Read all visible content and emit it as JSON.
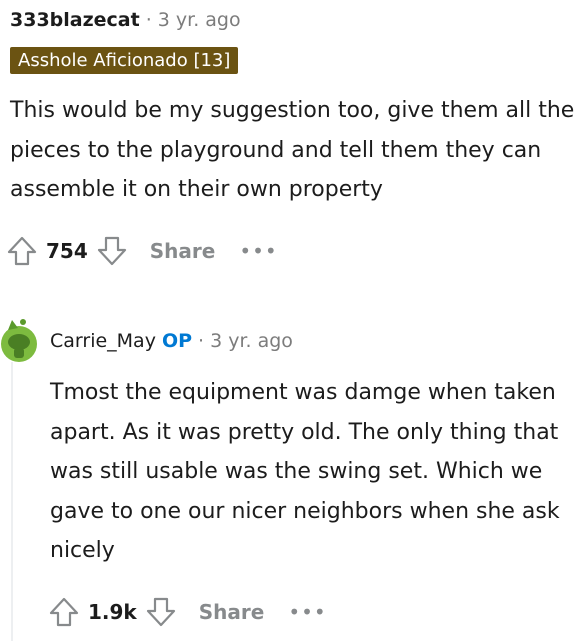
{
  "comment1": {
    "author": "333blazecat",
    "separator": "·",
    "time": "3 yr. ago",
    "flair": "Asshole Aficionado [13]",
    "body": "This would be my suggestion too, give them all the pieces to the playground and tell them they can assemble it on their own property",
    "score": "754",
    "share_label": "Share",
    "more_label": "•••"
  },
  "comment2": {
    "author": "Carrie_May",
    "op_badge": "OP",
    "separator": "·",
    "time": "3 yr. ago",
    "body": "Tmost the equipment was damge when taken apart. As it was pretty old. The only thing that was still usable was the swing set. Which we gave to one our nicer neighbors when she ask nicely",
    "score": "1.9k",
    "share_label": "Share",
    "more_label": "•••"
  },
  "colors": {
    "flair_bg": "#6b5312",
    "op": "#0079d3",
    "muted": "#878a8c",
    "avatar": "#7dbb3f"
  },
  "icons": [
    "upvote-icon",
    "downvote-icon",
    "snoo-avatar-icon"
  ]
}
